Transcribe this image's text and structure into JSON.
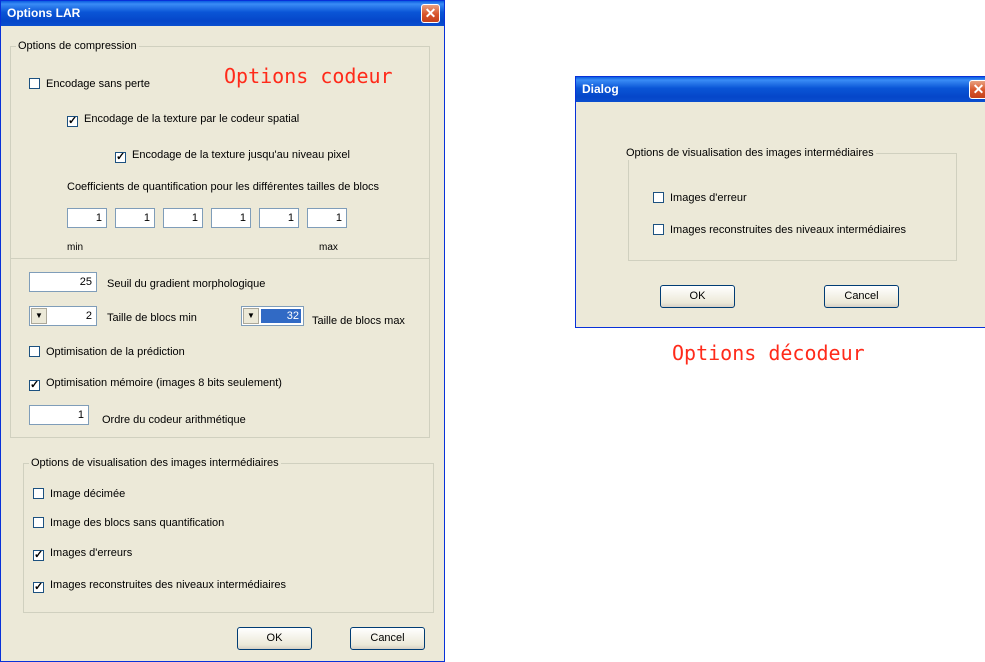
{
  "optionsWindow": {
    "title": "Options LAR",
    "close_glyph": "✕",
    "compression": {
      "group_title": "Options de compression",
      "lossless_label": "Encodage sans perte",
      "lossless_checked": false,
      "texture_spatial_label": "Encodage de la texture par le codeur spatial",
      "texture_spatial_checked": true,
      "texture_pixel_label": "Encodage de la texture jusqu'au niveau pixel",
      "texture_pixel_checked": true,
      "coefficients_label": "Coefficients de quantification pour les différentes tailles de blocs",
      "coefficients": [
        "1",
        "1",
        "1",
        "1",
        "1",
        "1"
      ],
      "min_label": "min",
      "max_label": "max"
    },
    "params": {
      "gradient_value": "25",
      "gradient_label": "Seuil du gradient morphologique",
      "min_block_value": "2",
      "min_block_label": "Taille de blocs min",
      "max_block_value": "32",
      "max_block_label": "Taille de blocs max",
      "prediction_label": "Optimisation de la prédiction",
      "prediction_checked": false,
      "memory_label": "Optimisation mémoire (images 8 bits seulement)",
      "memory_checked": true,
      "order_value": "1",
      "order_label": "Ordre du codeur arithmétique"
    },
    "visualisation": {
      "group_title": "Options de visualisation des images intermédiaires",
      "items": [
        {
          "label": "Image décimée",
          "checked": false
        },
        {
          "label": "Image des blocs sans quantification",
          "checked": false
        },
        {
          "label": "Images d'erreurs",
          "checked": true
        },
        {
          "label": "Images reconstruites des niveaux intermédiaires",
          "checked": true
        }
      ]
    },
    "ok_label": "OK",
    "cancel_label": "Cancel"
  },
  "dialogWindow": {
    "title": "Dialog",
    "group_title": "Options de visualisation des images intermédiaires",
    "items": [
      {
        "label": "Images d'erreur",
        "checked": false
      },
      {
        "label": "Images reconstruites des niveaux intermédiaires",
        "checked": false
      }
    ],
    "ok_label": "OK",
    "cancel_label": "Cancel"
  },
  "annotations": {
    "encoder": "Options codeur",
    "decoder": "Options décodeur"
  },
  "colors": {
    "titlebar": "#0a55d6",
    "dialog_face": "#ece9d8",
    "annotation": "#ff2a1a",
    "selection": "#316ac5"
  },
  "icons": {
    "check": "✓",
    "spin_arrow": "▼"
  }
}
